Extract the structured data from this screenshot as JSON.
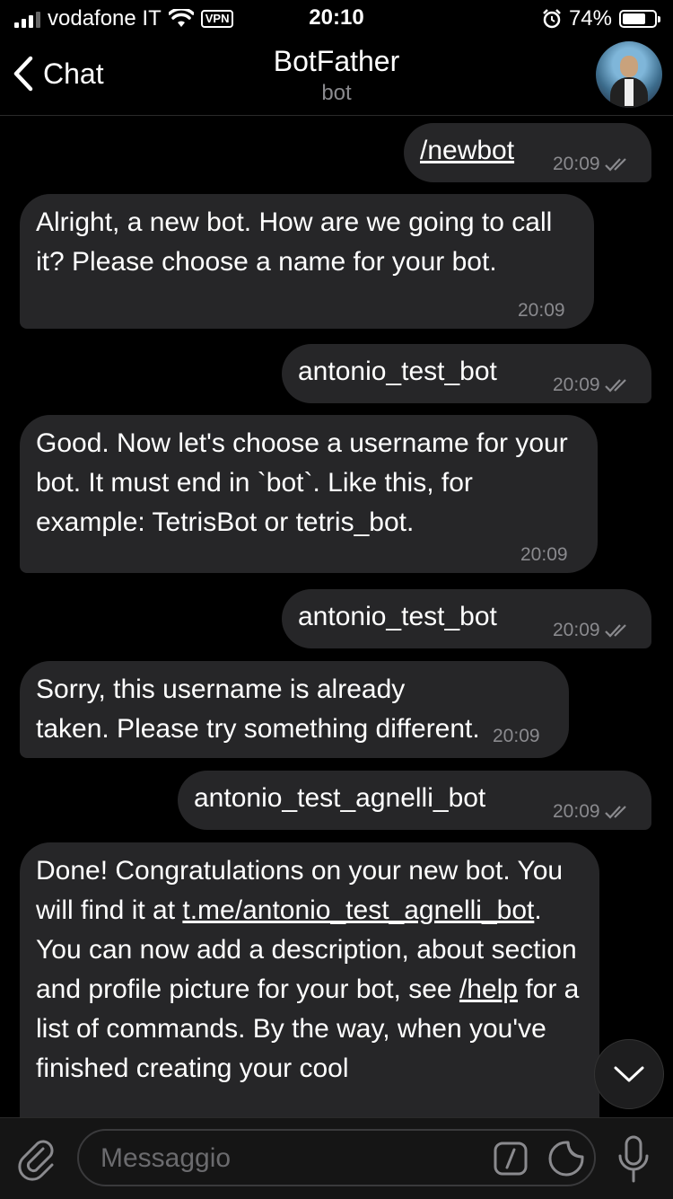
{
  "status_bar": {
    "carrier": "vodafone IT",
    "vpn_label": "VPN",
    "time": "20:10",
    "battery": "74%",
    "battery_level": 0.74
  },
  "header": {
    "back_label": "Chat",
    "title": "BotFather",
    "subtitle": "bot"
  },
  "messages": [
    {
      "dir": "out",
      "text": "/newbot",
      "time": "20:09"
    },
    {
      "dir": "in",
      "text": "Alright, a new bot. How are we going to call it? Please choose a name for your bot.",
      "time": "20:09"
    },
    {
      "dir": "out",
      "text": "antonio_test_bot",
      "time": "20:09"
    },
    {
      "dir": "in",
      "text": "Good. Now let's choose a username for your bot. It must end in `bot`. Like this, for example: TetrisBot or tetris_bot.",
      "time": "20:09"
    },
    {
      "dir": "out",
      "text": "antonio_test_bot",
      "time": "20:09"
    },
    {
      "dir": "in",
      "text": "Sorry, this username is already taken. Please try something different.",
      "time": "20:09"
    },
    {
      "dir": "out",
      "text": "antonio_test_agnelli_bot",
      "time": "20:09"
    },
    {
      "dir": "in",
      "parts": {
        "p1": "Done! Congratulations on your new bot. You will find it at ",
        "link1": "t.me/antonio_test_agnelli_bot",
        "p2": ". You can now add a description, about section and profile picture for your bot, see ",
        "link2": "/help",
        "p3": " for a list of commands. By the way, when you've finished creating your cool"
      }
    }
  ],
  "input": {
    "placeholder": "Messaggio",
    "value": ""
  },
  "colors": {
    "background": "#000000",
    "bubble": "#262628",
    "meta_text": "#8a8a8e"
  },
  "icons": {
    "attach": "paperclip-icon",
    "commands": "slash-command-icon",
    "sticker": "sticker-icon",
    "voice": "microphone-icon",
    "scroll": "chevron-down-icon",
    "read": "double-check-icon"
  }
}
